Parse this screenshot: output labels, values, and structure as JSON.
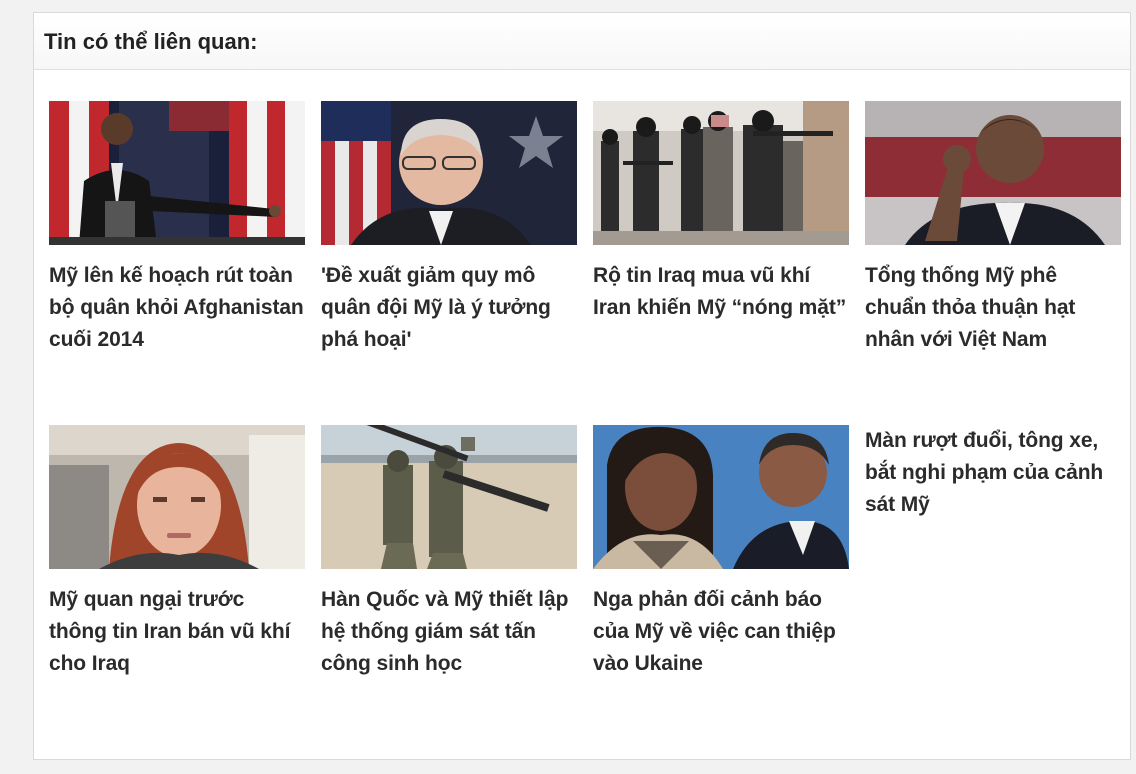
{
  "section": {
    "title": "Tin có thể liên quan:"
  },
  "colors": {
    "background": "#f2f2f2",
    "panel": "#ffffff",
    "text": "#2b2b2b"
  },
  "articles": [
    {
      "title": "Mỹ lên kế hoạch rút toàn bộ quân khỏi Afghanistan cuối 2014",
      "image": "photo-speaker-flags"
    },
    {
      "title": "'Đề xuất giảm quy mô quân đội Mỹ là ý tưởng phá hoại'",
      "image": "photo-man-glasses-flag"
    },
    {
      "title": "Rộ tin Iraq mua vũ khí Iran khiến Mỹ “nóng mặt”",
      "image": "photo-armed-militants"
    },
    {
      "title": "Tổng thống Mỹ phê chuẩn thỏa thuận hạt nhân với Việt Nam",
      "image": "photo-president-gesture"
    },
    {
      "title": "Mỹ quan ngại trước thông tin Iran bán vũ khí cho Iraq",
      "image": "photo-woman-portrait"
    },
    {
      "title": "Hàn Quốc và Mỹ thiết lập hệ thống giám sát tấn công sinh học",
      "image": "photo-soldiers-beach"
    },
    {
      "title": "Nga phản đối cảnh báo của Mỹ về việc can thiệp vào Ukaine",
      "image": "photo-officials-meeting"
    },
    {
      "title": "Màn rượt đuổi, tông xe, bắt nghi phạm của cảnh sát Mỹ",
      "image": ""
    }
  ]
}
